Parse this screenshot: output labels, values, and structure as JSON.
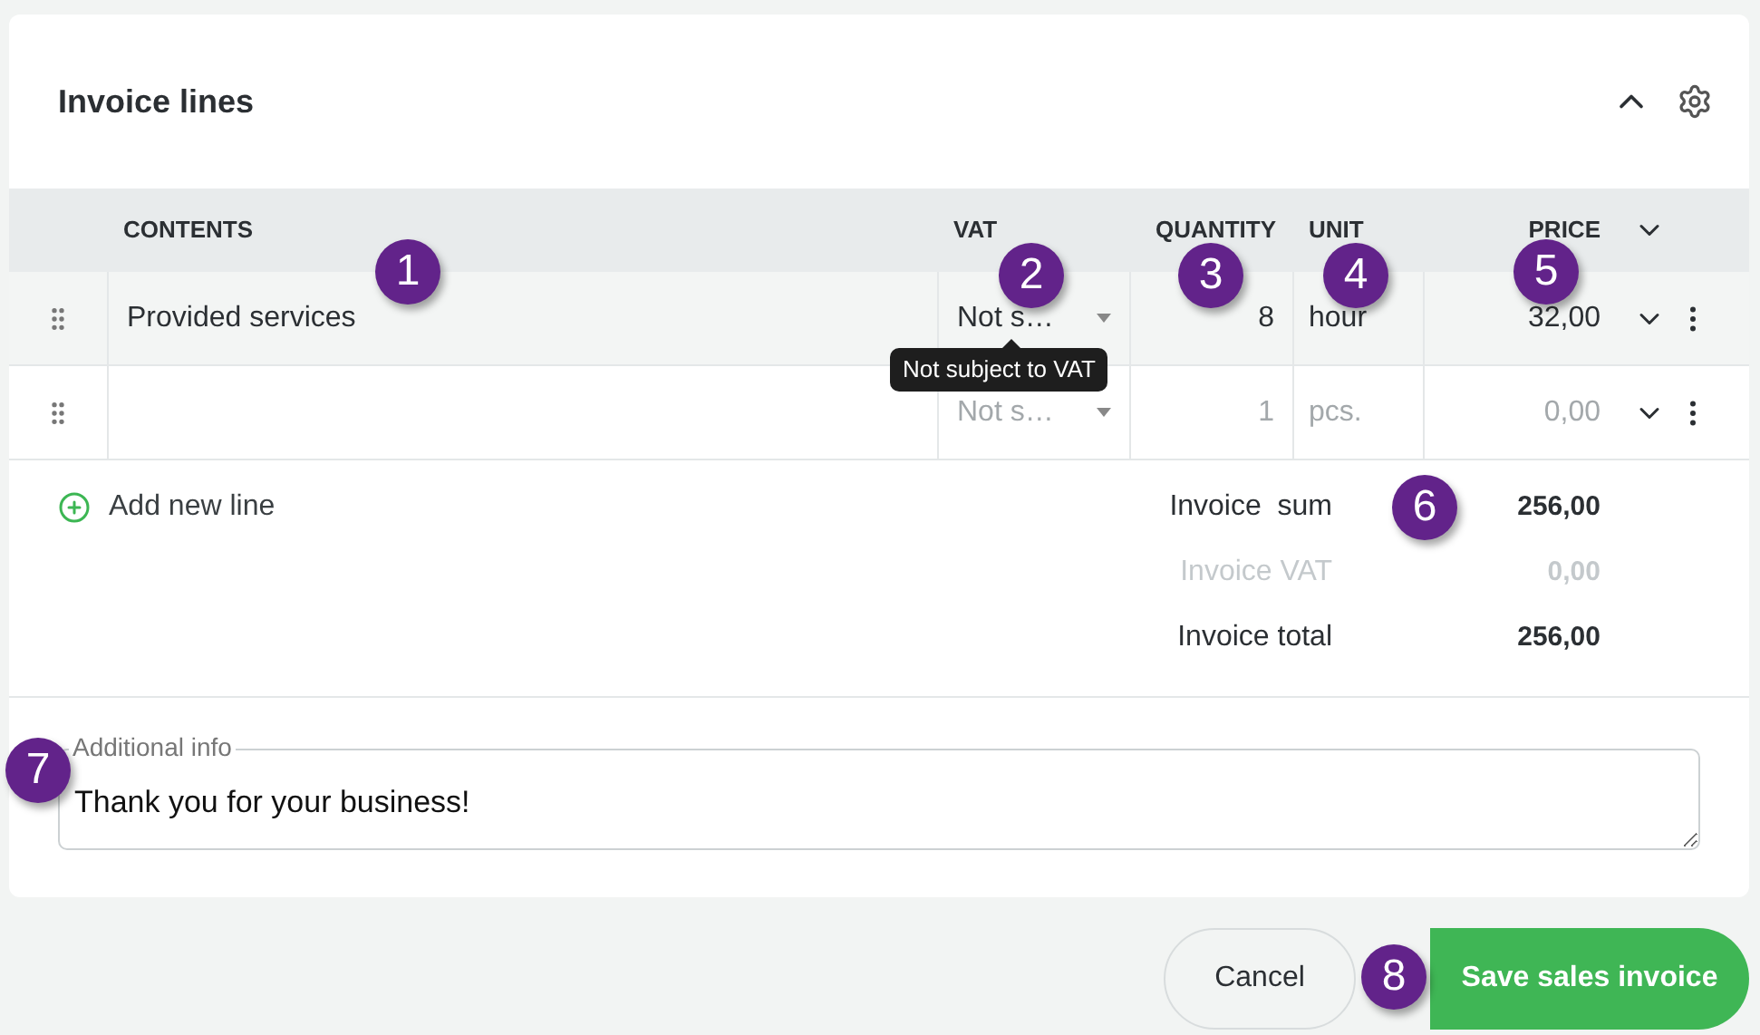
{
  "section": {
    "title": "Invoice lines"
  },
  "columns": [
    "CONTENTS",
    "VAT",
    "QUANTITY",
    "UNIT",
    "PRICE"
  ],
  "rows": [
    {
      "contents": "Provided services",
      "vat": "Not s…",
      "quantity": "8",
      "unit": "hour",
      "price": "32,00",
      "muted": false,
      "selected": true,
      "tooltip": "Not subject to VAT"
    },
    {
      "vat": "Not s…",
      "quantity": "1",
      "unit": "pcs.",
      "price": "0,00",
      "muted": true,
      "selected": false
    }
  ],
  "add_line": "Add new line",
  "totals": [
    {
      "label": "Invoice  sum",
      "value": "256,00",
      "muted": false
    },
    {
      "label": "Invoice VAT",
      "value": "0,00",
      "muted": true
    },
    {
      "label": "Invoice total",
      "value": "256,00",
      "muted": false
    }
  ],
  "additional_info": {
    "label": "Additional info",
    "value": "Thank you for your business!"
  },
  "buttons": {
    "cancel": "Cancel",
    "save": "Save sales invoice"
  },
  "callouts": [
    "1",
    "2",
    "3",
    "4",
    "5",
    "6",
    "7",
    "8"
  ]
}
